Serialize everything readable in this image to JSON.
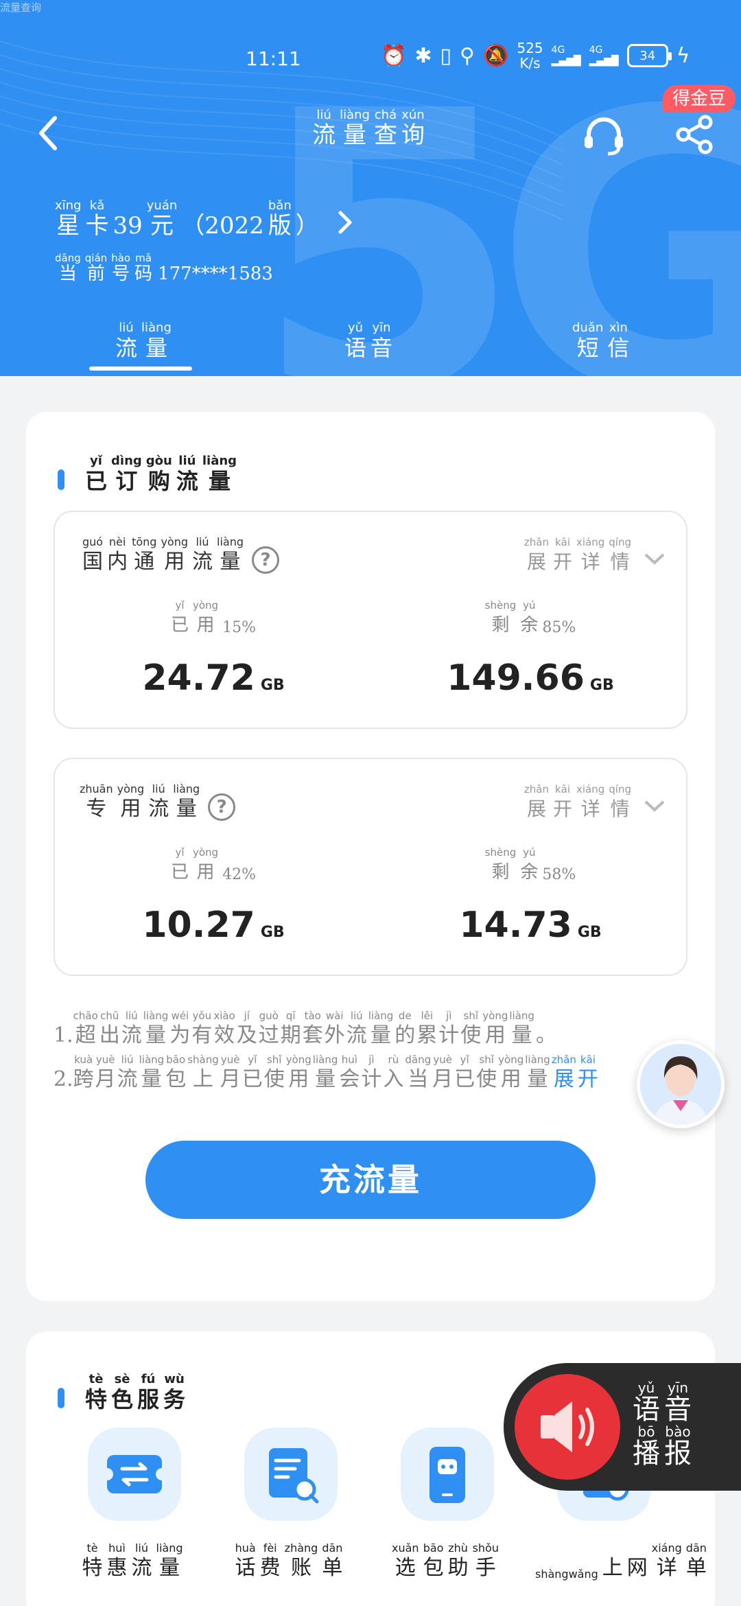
{
  "top_note": "流量查询",
  "status": {
    "time": "11:11",
    "speed_value": "525",
    "speed_unit": "K/s",
    "battery": "34"
  },
  "nav": {
    "title": [
      [
        "liú",
        "流"
      ],
      [
        "liàng",
        "量"
      ],
      [
        "chá",
        "查"
      ],
      [
        "xún",
        "询"
      ]
    ],
    "badge": "得金豆"
  },
  "plan": {
    "name": [
      [
        "xīng",
        "星"
      ],
      [
        "kǎ",
        "卡"
      ],
      [
        "",
        "39"
      ],
      [
        "yuán",
        "元"
      ],
      [
        "",
        "（2022"
      ],
      [
        "bǎn",
        "版"
      ],
      [
        "",
        "）"
      ]
    ],
    "number_label": [
      [
        "dāng",
        "当"
      ],
      [
        "qián",
        "前"
      ],
      [
        "hào",
        "号"
      ],
      [
        "mǎ",
        "码"
      ]
    ],
    "number_value": "177****1583"
  },
  "tabs": [
    {
      "label": [
        [
          "liú",
          "流"
        ],
        [
          "liàng",
          "量"
        ]
      ],
      "active": true
    },
    {
      "label": [
        [
          "yǔ",
          "语"
        ],
        [
          "yīn",
          "音"
        ]
      ],
      "active": false
    },
    {
      "label": [
        [
          "duǎn",
          "短"
        ],
        [
          "xìn",
          "信"
        ]
      ],
      "active": false
    }
  ],
  "section_ordered": [
    [
      "yǐ",
      "已"
    ],
    [
      "dìng",
      "订"
    ],
    [
      "gòu",
      "购"
    ],
    [
      "liú",
      "流"
    ],
    [
      "liàng",
      "量"
    ]
  ],
  "expand_label": [
    [
      "zhǎn",
      "展"
    ],
    [
      "kāi",
      "开"
    ],
    [
      "xiáng",
      "详"
    ],
    [
      "qíng",
      "情"
    ]
  ],
  "used_label": [
    [
      "yǐ",
      "已"
    ],
    [
      "yòng",
      "用"
    ]
  ],
  "remaining_label": [
    [
      "shèng",
      "剩"
    ],
    [
      "yú",
      "余"
    ]
  ],
  "boxes": [
    {
      "title": [
        [
          "guó",
          "国"
        ],
        [
          "nèi",
          "内"
        ],
        [
          "tōng",
          "通"
        ],
        [
          "yòng",
          "用"
        ],
        [
          "liú",
          "流"
        ],
        [
          "liàng",
          "量"
        ]
      ],
      "used_pct": "15%",
      "remaining_pct": "85%",
      "used_value": "24.72",
      "remaining_value": "149.66",
      "unit": "GB"
    },
    {
      "title": [
        [
          "zhuān",
          "专"
        ],
        [
          "yòng",
          "用"
        ],
        [
          "liú",
          "流"
        ],
        [
          "liàng",
          "量"
        ]
      ],
      "used_pct": "42%",
      "remaining_pct": "58%",
      "used_value": "10.27",
      "remaining_value": "14.73",
      "unit": "GB"
    }
  ],
  "notes": [
    {
      "num": "1.",
      "text": [
        [
          "chāo",
          "超"
        ],
        [
          "chū",
          "出"
        ],
        [
          "liú",
          "流"
        ],
        [
          "liàng",
          "量"
        ],
        [
          "wéi",
          "为"
        ],
        [
          "yǒu",
          "有"
        ],
        [
          "xiào",
          "效"
        ],
        [
          "jí",
          "及"
        ],
        [
          "guò",
          "过"
        ],
        [
          "qī",
          "期"
        ],
        [
          "tào",
          "套"
        ],
        [
          "wài",
          "外"
        ],
        [
          "liú",
          "流"
        ],
        [
          "liàng",
          "量"
        ],
        [
          "de",
          "的"
        ],
        [
          "lěi",
          "累"
        ],
        [
          "jì",
          "计"
        ],
        [
          "shǐ",
          "使"
        ],
        [
          "yòng",
          "用"
        ],
        [
          "liàng",
          "量"
        ],
        [
          "",
          "。"
        ]
      ]
    },
    {
      "num": "2.",
      "text": [
        [
          "kuà",
          "跨"
        ],
        [
          "yuè",
          "月"
        ],
        [
          "liú",
          "流"
        ],
        [
          "liàng",
          "量"
        ],
        [
          "bāo",
          "包"
        ],
        [
          "shàng",
          "上"
        ],
        [
          "yuè",
          "月"
        ],
        [
          "yǐ",
          "已"
        ],
        [
          "shǐ",
          "使"
        ],
        [
          "yòng",
          "用"
        ],
        [
          "liàng",
          "量"
        ],
        [
          "huì",
          "会"
        ],
        [
          "jì",
          "计"
        ],
        [
          "rù",
          "入"
        ],
        [
          "dāng",
          "当"
        ],
        [
          "yuè",
          "月"
        ],
        [
          "yǐ",
          "已"
        ],
        [
          "shǐ",
          "使"
        ],
        [
          "yòng",
          "用"
        ],
        [
          "liàng",
          "量"
        ]
      ],
      "link": [
        [
          "zhǎn",
          "展"
        ],
        [
          "kāi",
          "开"
        ]
      ]
    }
  ],
  "recharge_label": "充流量",
  "section_services": [
    [
      "tè",
      "特"
    ],
    [
      "sè",
      "色"
    ],
    [
      "fú",
      "服"
    ],
    [
      "wù",
      "务"
    ]
  ],
  "services": [
    {
      "label": [
        [
          "tè",
          "特"
        ],
        [
          "huì",
          "惠"
        ],
        [
          "liú",
          "流"
        ],
        [
          "liàng",
          "量"
        ]
      ],
      "icon": "ticket-icon"
    },
    {
      "label": [
        [
          "huà",
          "话"
        ],
        [
          "fèi",
          "费"
        ],
        [
          "zhàng",
          "账"
        ],
        [
          "dān",
          "单"
        ]
      ],
      "icon": "bill-search-icon"
    },
    {
      "label": [
        [
          "xuǎn",
          "选"
        ],
        [
          "bāo",
          "包"
        ],
        [
          "zhù",
          "助"
        ],
        [
          "shǒu",
          "手"
        ]
      ],
      "icon": "phone-robot-icon"
    },
    {
      "label": [
        [
          "shàngwǎng",
          ""
        ],
        [
          "",
          "上"
        ],
        [
          "",
          "网"
        ],
        [
          "xiáng",
          "详"
        ],
        [
          "dān",
          "单"
        ]
      ],
      "icon": "detail-list-icon"
    }
  ],
  "voice_panel": [
    [
      [
        "yǔ",
        "语"
      ],
      [
        "yīn",
        "音"
      ]
    ],
    [
      [
        "bō",
        "播"
      ],
      [
        "bào",
        "报"
      ]
    ]
  ],
  "colors": {
    "accent": "#2f8ff2",
    "badge": "#ff5b64",
    "voice": "#e8323a"
  }
}
